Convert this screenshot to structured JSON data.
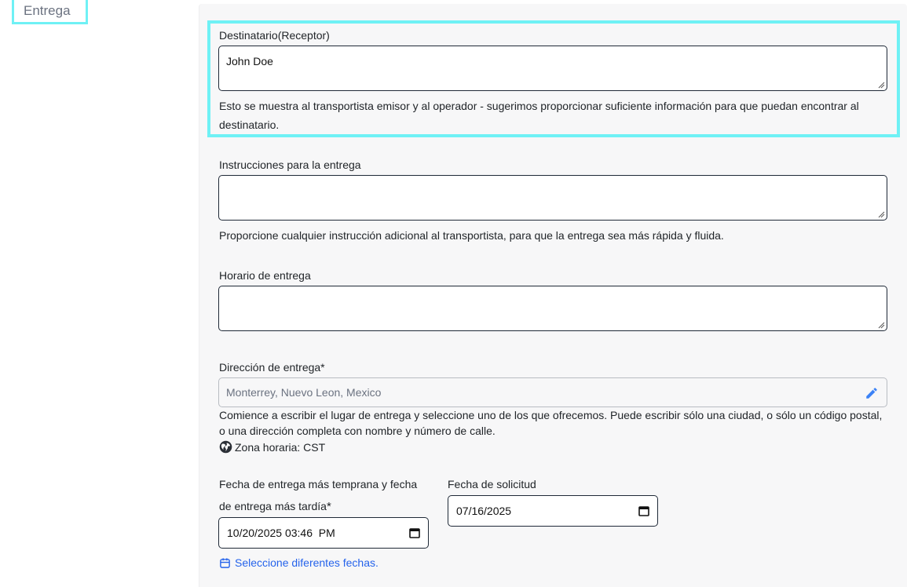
{
  "section": {
    "title": "Entrega"
  },
  "recipient": {
    "label": "Destinatario(Receptor)",
    "value": "John Doe",
    "help": "Esto se muestra al transportista emisor y al operador - sugerimos proporcionar suficiente información para que puedan encontrar al destinatario."
  },
  "instructions": {
    "label": "Instrucciones para la entrega",
    "value": "",
    "help": "Proporcione cualquier instrucción adicional al transportista, para que la entrega sea más rápida y fluida."
  },
  "schedule": {
    "label": "Horario de entrega",
    "value": ""
  },
  "address": {
    "label": "Dirección de entrega*",
    "placeholder": "Monterrey, Nuevo Leon, Mexico",
    "help": "Comience a escribir el lugar de entrega y seleccione uno de los que ofrecemos. Puede escribir sólo una ciudad, o sólo un código postal, o una dirección completa con nombre y número de calle.",
    "timezone": "Zona horaria: CST"
  },
  "dates": {
    "window_label_line1": "Fecha de entrega más temprana y fecha",
    "window_label_line2": "de entrega más tardía",
    "window_required": "*",
    "window_value": "10/20/2025 03:46  PM",
    "request_label": "Fecha de solicitud",
    "request_value": "07/16/2025",
    "different_dates_link": "Seleccione diferentes fechas."
  },
  "colors": {
    "highlight": "#6ff1f5",
    "link": "#2563eb",
    "panel_bg": "#f7f7f8"
  }
}
